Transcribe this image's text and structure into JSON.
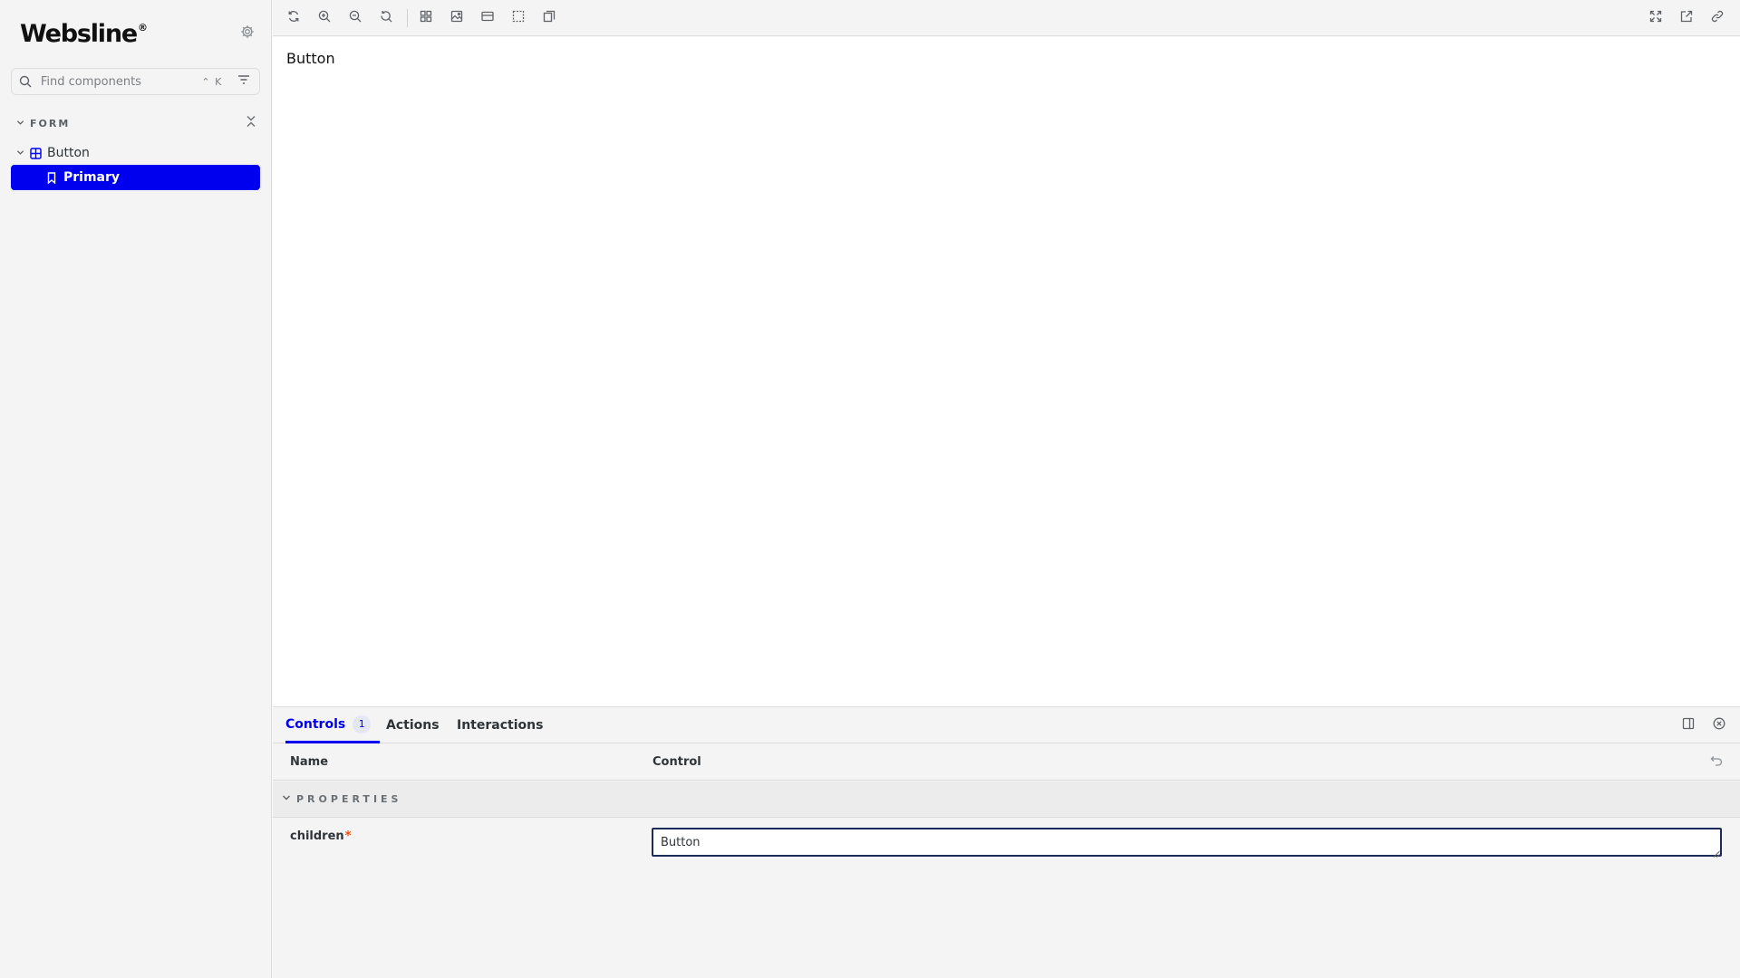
{
  "sidebar": {
    "brand": "Websline",
    "brand_mark": "®",
    "search": {
      "placeholder": "Find components",
      "shortcut": "⌃ K"
    },
    "group": {
      "title": "FORM"
    },
    "tree": [
      {
        "label": "Button",
        "icon": "component-icon",
        "expanded": true,
        "stories": [
          {
            "label": "Primary",
            "icon": "bookmark-icon",
            "selected": true
          }
        ]
      }
    ]
  },
  "toolbar": {
    "left": [
      "reload-icon",
      "zoom-in-icon",
      "zoom-out-icon",
      "reset-zoom-icon",
      "grid-icon",
      "background-icon",
      "viewport-icon",
      "outline-icon",
      "measure-icon"
    ],
    "right": [
      "fullscreen-icon",
      "open-new-tab-icon",
      "copy-link-icon"
    ]
  },
  "canvas": {
    "preview_button_text": "Button"
  },
  "panel": {
    "tabs": [
      {
        "label": "Controls",
        "count": "1",
        "active": true
      },
      {
        "label": "Actions"
      },
      {
        "label": "Interactions"
      }
    ],
    "columns": {
      "name": "Name",
      "control": "Control"
    },
    "section": {
      "title": "PROPERTIES"
    },
    "rows": [
      {
        "name": "children",
        "required_mark": "*",
        "value": "Button"
      }
    ]
  },
  "colors": {
    "accent": "#0000ee",
    "required": "#ff4400",
    "sidebar_bg": "#f4f4f4",
    "canvas_bg": "#ffffff"
  }
}
